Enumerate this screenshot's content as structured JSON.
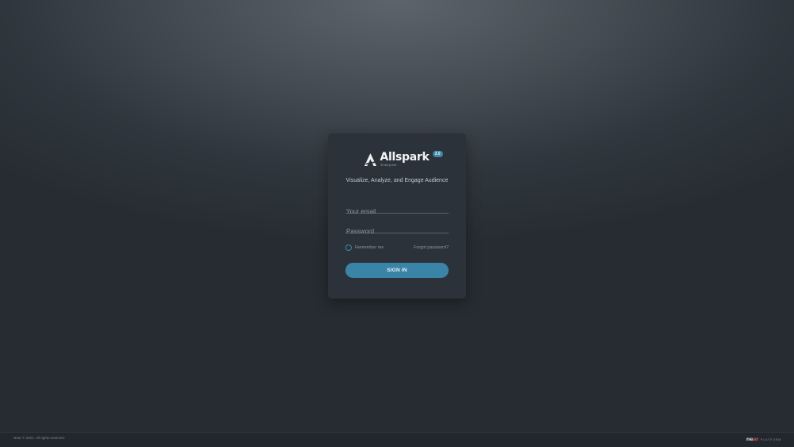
{
  "brand": {
    "name": "Allspark",
    "version": "3.0",
    "edition": "Enterprise",
    "tagline": "Visualize, Analyze, and Engage Audience"
  },
  "form": {
    "email": {
      "placeholder": "Your email",
      "value": ""
    },
    "password": {
      "placeholder": "Password",
      "value": ""
    },
    "remember_label": "Remember me",
    "remember_checked": false,
    "forgot_label": "Forgot password?",
    "signin_label": "SIGN IN"
  },
  "footer": {
    "copyright": "Near © 2021. All rights reserved",
    "platform_brand_prefix": "ne",
    "platform_brand_accent": "ar",
    "platform_word": "PLATFORM"
  },
  "colors": {
    "accent": "#3a84a7",
    "card": "#2b3239",
    "platform_accent": "#d2464f"
  }
}
